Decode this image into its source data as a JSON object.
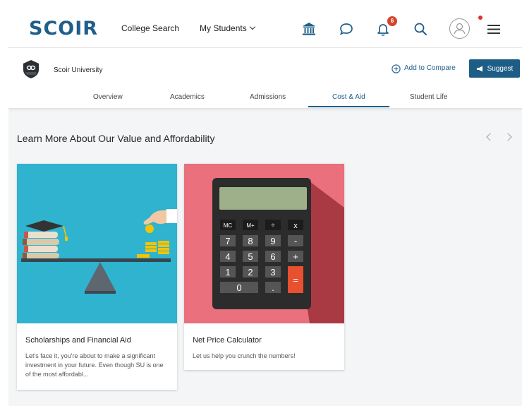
{
  "nav": {
    "logo": "SCOIR",
    "college_search": "College Search",
    "my_students": "My Students",
    "notification_count": "6",
    "icons": [
      "institution-icon",
      "chat-icon",
      "bell-icon",
      "search-icon",
      "avatar-icon",
      "menu-icon"
    ]
  },
  "school": {
    "name": "Scoir University",
    "compare_label": "Add to Compare",
    "suggest_label": "Suggest"
  },
  "tabs": [
    {
      "label": "Overview",
      "active": false
    },
    {
      "label": "Academics",
      "active": false
    },
    {
      "label": "Admissions",
      "active": false
    },
    {
      "label": "Cost & Aid",
      "active": true
    },
    {
      "label": "Student Life",
      "active": false
    }
  ],
  "section": {
    "title": "Learn More About Our Value and Affordability"
  },
  "cards": [
    {
      "title": "Scholarships and Financial Aid",
      "description": "Let's face it, you're about to make a significant investment in your future. Even though SU is one of the most affordabl..."
    },
    {
      "title": "Net Price Calculator",
      "description": "Let us help you crunch the numbers!"
    }
  ],
  "calculator": {
    "keys": [
      "MC",
      "M+",
      "÷",
      "x",
      "7",
      "8",
      "9",
      "-",
      "4",
      "5",
      "6",
      "+",
      "1",
      "2",
      "3",
      "=",
      "0",
      "."
    ]
  },
  "colors": {
    "brand": "#1f5f8b",
    "suggest_bg": "#1d5d86",
    "badge": "#d5452b",
    "card1_bg": "#2fb3cf",
    "card2_bg": "#e9707c"
  }
}
